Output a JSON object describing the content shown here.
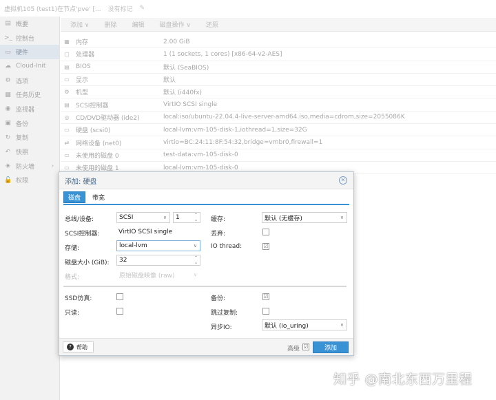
{
  "topbar": {
    "title": "虚拟机105 (test1)在节点'pve' [...",
    "note": "没有标记"
  },
  "sidebar": {
    "items": [
      {
        "icon": "summary-icon",
        "glyph": "▤",
        "label": "概要"
      },
      {
        "icon": "console-icon",
        "glyph": ">_",
        "label": "控制台"
      },
      {
        "icon": "hardware-icon",
        "glyph": "▭",
        "label": "硬件",
        "active": true
      },
      {
        "icon": "cloud-icon",
        "glyph": "☁",
        "label": "Cloud-Init"
      },
      {
        "icon": "gear-icon",
        "glyph": "⚙",
        "label": "选项"
      },
      {
        "icon": "task-history-icon",
        "glyph": "▦",
        "label": "任务历史"
      },
      {
        "icon": "monitor-icon",
        "glyph": "◉",
        "label": "监视器"
      },
      {
        "icon": "backup-icon",
        "glyph": "▣",
        "label": "备份"
      },
      {
        "icon": "replication-icon",
        "glyph": "↻",
        "label": "复制"
      },
      {
        "icon": "snapshot-icon",
        "glyph": "↶",
        "label": "快照"
      },
      {
        "icon": "firewall-icon",
        "glyph": "◈",
        "label": "防火墙",
        "chevron": "›"
      },
      {
        "icon": "permissions-icon",
        "glyph": "🔓",
        "label": "权限"
      }
    ]
  },
  "toolbar": {
    "add": "添加 ∨",
    "remove": "删除",
    "edit": "编辑",
    "disk_action": "磁盘操作 ∨",
    "revert": "还原"
  },
  "hardware": [
    {
      "icon": "memory-icon",
      "glyph": "▦",
      "name": "内存",
      "value": "2.00 GiB"
    },
    {
      "icon": "processor-icon",
      "glyph": "▢",
      "name": "处理器",
      "value": "1 (1 sockets, 1 cores) [x86-64-v2-AES]"
    },
    {
      "icon": "bios-icon",
      "glyph": "▤",
      "name": "BIOS",
      "value": "默认 (SeaBIOS)"
    },
    {
      "icon": "display-icon",
      "glyph": "▭",
      "name": "显示",
      "value": "默认"
    },
    {
      "icon": "machine-icon",
      "glyph": "⚙",
      "name": "机型",
      "value": "默认 (i440fx)"
    },
    {
      "icon": "scsi-controller-icon",
      "glyph": "▤",
      "name": "SCSI控制器",
      "value": "VirtIO SCSI single"
    },
    {
      "icon": "cdrom-icon",
      "glyph": "◎",
      "name": "CD/DVD驱动器 (ide2)",
      "value": "local:iso/ubuntu-22.04.4-live-server-amd64.iso,media=cdrom,size=2055086K"
    },
    {
      "icon": "harddisk-icon",
      "glyph": "▭",
      "name": "硬盘 (scsi0)",
      "value": "local-lvm:vm-105-disk-1,iothread=1,size=32G"
    },
    {
      "icon": "network-icon",
      "glyph": "⇄",
      "name": "网络设备 (net0)",
      "value": "virtio=BC:24:11:8F:54:32,bridge=vmbr0,firewall=1"
    },
    {
      "icon": "unused-disk-icon",
      "glyph": "▭",
      "name": "未使用的磁盘 0",
      "value": "test-data:vm-105-disk-0"
    },
    {
      "icon": "unused-disk-icon",
      "glyph": "▭",
      "name": "未使用的磁盘 1",
      "value": "local-lvm:vm-105-disk-0"
    }
  ],
  "dialog": {
    "title": "添加: 硬盘",
    "close_glyph": "✕",
    "tabs": [
      "磁盘",
      "带宽"
    ],
    "bus_label": "总线/设备:",
    "bus_value": "SCSI",
    "bus_index": "1",
    "scsi_ctrl_label": "SCSI控制器:",
    "scsi_ctrl_value": "VirtIO SCSI single",
    "storage_label": "存储:",
    "storage_value": "local-lvm",
    "size_label": "磁盘大小 (GiB):",
    "size_value": "32",
    "format_label": "格式:",
    "format_value": "原始磁盘映像 (raw)",
    "cache_label": "缓存:",
    "cache_value": "默认 (无缓存)",
    "discard_label": "丢弃:",
    "iothread_label": "IO thread:",
    "ssd_label": "SSD仿真:",
    "readonly_label": "只读:",
    "backup_label": "备份:",
    "skip_repl_label": "跳过复制:",
    "async_io_label": "异步IO:",
    "async_io_value": "默认 (io_uring)",
    "check_glyph": "☑",
    "help_label": "帮助",
    "help_glyph": "?",
    "advanced_label": "高级",
    "add_label": "添加",
    "arrow_glyph": "∨",
    "spin_up": "⌃",
    "spin_down": "⌄"
  },
  "watermark": "知乎 @南北东西万里程"
}
